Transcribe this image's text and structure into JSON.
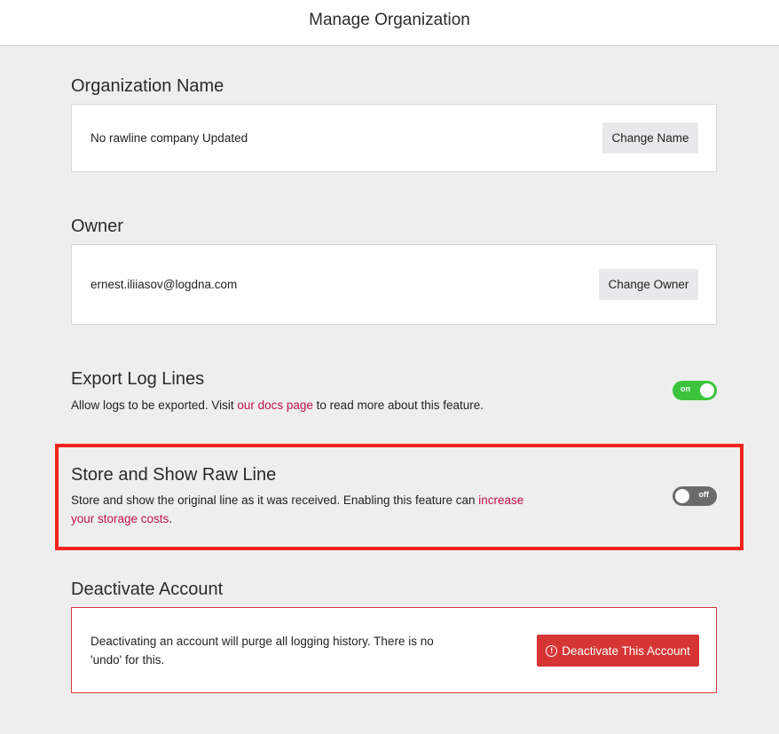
{
  "header": {
    "title": "Manage Organization"
  },
  "org_name": {
    "title": "Organization Name",
    "value": "No rawline company Updated",
    "button": "Change Name"
  },
  "owner": {
    "title": "Owner",
    "value": "ernest.iliiasov@logdna.com",
    "button": "Change Owner"
  },
  "export": {
    "title": "Export Log Lines",
    "desc_before": "Allow logs to be exported. Visit ",
    "link": "our docs page",
    "desc_after": " to read more about this feature.",
    "toggle_label": "on",
    "toggle_state": "on"
  },
  "rawline": {
    "title": "Store and Show Raw Line",
    "desc_before": "Store and show the original line as it was received. Enabling this feature can ",
    "link": "increase your storage costs",
    "desc_after": ".",
    "toggle_label": "off",
    "toggle_state": "off"
  },
  "deactivate": {
    "title": "Deactivate Account",
    "desc": "Deactivating an account will purge all logging history. There is no 'undo' for this.",
    "button": "Deactivate This Account",
    "icon": "alert-circle-icon"
  },
  "colors": {
    "link": "#c0124b",
    "toggle_on": "#3cc43c",
    "toggle_off": "#6b6b6b",
    "danger": "#d63535",
    "highlight": "#f3241c"
  }
}
